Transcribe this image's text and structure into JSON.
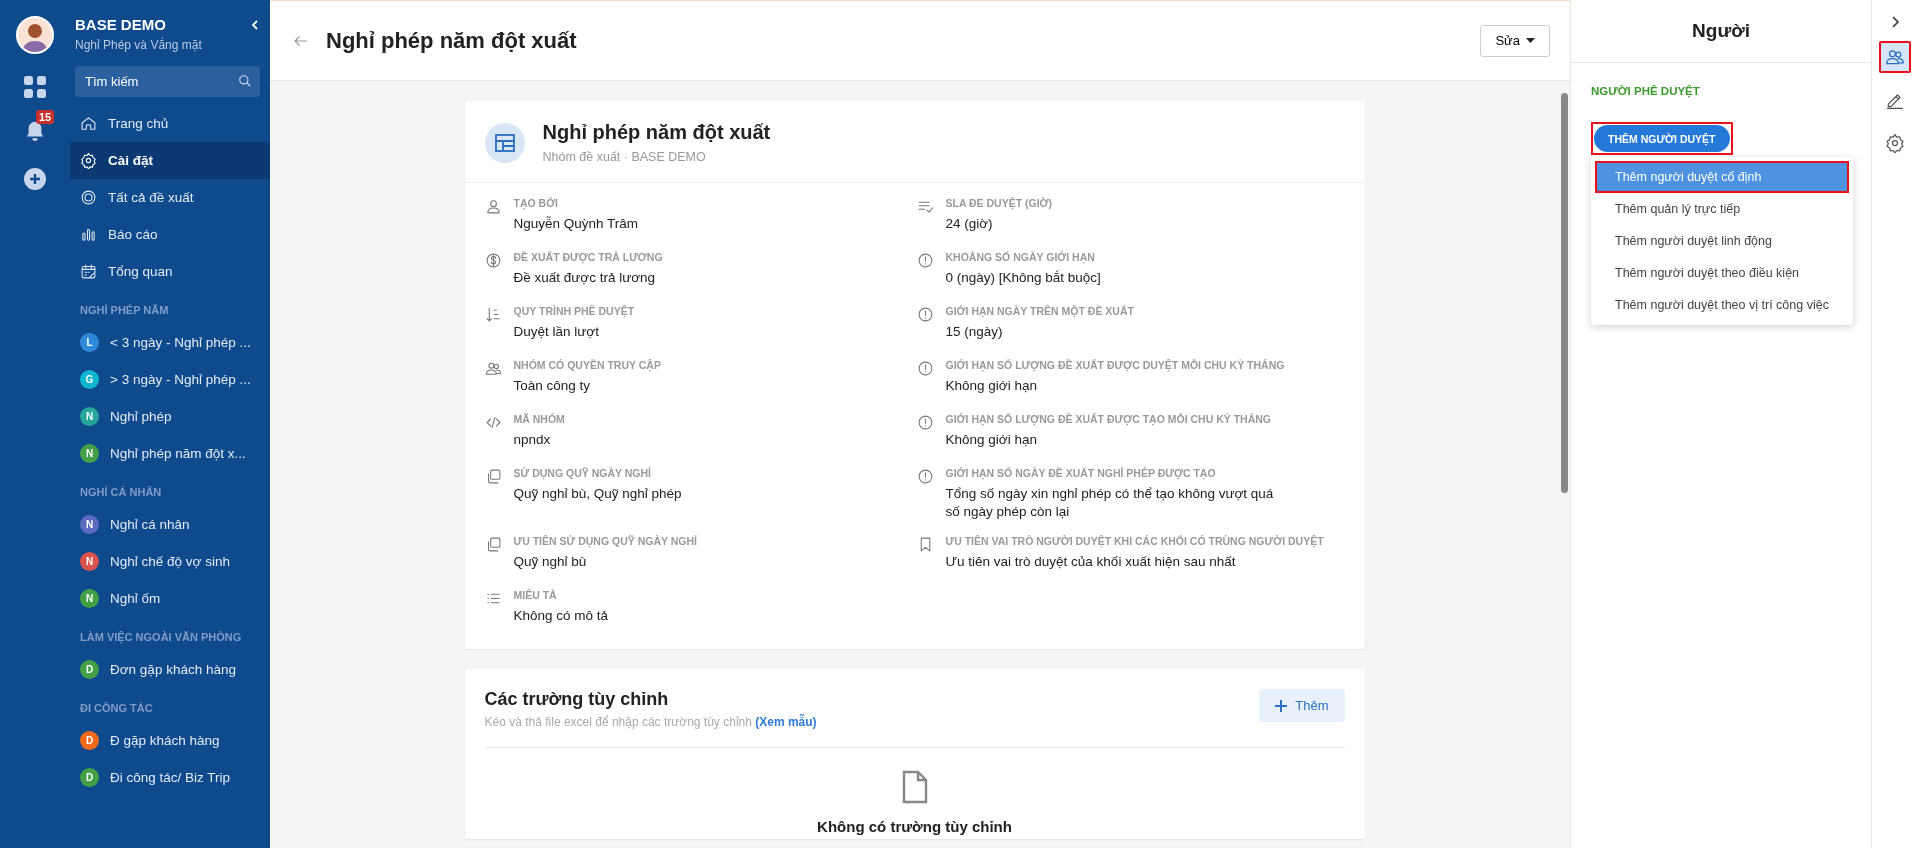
{
  "sidebar": {
    "org": "BASE DEMO",
    "app": "Nghỉ Phép và Vắng mặt",
    "search": {
      "placeholder": "Tìm kiếm"
    },
    "notifications": "15",
    "nav": [
      {
        "label": "Trang chủ",
        "selected": false
      },
      {
        "label": "Cài đặt",
        "selected": true
      },
      {
        "label": "Tất cả đề xuất",
        "selected": false
      },
      {
        "label": "Báo cáo",
        "selected": false
      },
      {
        "label": "Tổng quan",
        "selected": false
      }
    ],
    "groups": [
      {
        "title": "NGHỈ PHÉP NĂM",
        "items": [
          {
            "letter": "L",
            "color": "#2e8ad8",
            "label": "< 3 ngày - Nghỉ phép ..."
          },
          {
            "letter": "G",
            "color": "#11b5cf",
            "label": "> 3 ngày - Nghỉ phép ..."
          },
          {
            "letter": "N",
            "color": "#26a69a",
            "label": "Nghỉ phép"
          },
          {
            "letter": "N",
            "color": "#43a047",
            "label": "Nghỉ phép năm đột x..."
          }
        ]
      },
      {
        "title": "NGHỈ CÁ NHÂN",
        "items": [
          {
            "letter": "N",
            "color": "#5c6bc0",
            "label": "Nghỉ cá nhân"
          },
          {
            "letter": "N",
            "color": "#d9534f",
            "label": "Nghỉ chế độ vợ sinh"
          },
          {
            "letter": "N",
            "color": "#43a047",
            "label": "Nghỉ ốm"
          }
        ]
      },
      {
        "title": "LÀM VIỆC NGOÀI VĂN PHÒNG",
        "items": [
          {
            "letter": "D",
            "color": "#43a047",
            "label": "Đơn gặp khách hàng"
          }
        ]
      },
      {
        "title": "ĐI CÔNG TÁC",
        "items": [
          {
            "letter": "D",
            "color": "#f26b1d",
            "label": "Đ gặp khách hàng"
          },
          {
            "letter": "D",
            "color": "#43a047",
            "label": "Đi công tác/ Biz Trip"
          }
        ]
      }
    ]
  },
  "header": {
    "title": "Nghỉ phép năm đột xuất",
    "edit_button": "Sửa"
  },
  "card": {
    "title": "Nghỉ phép năm đột xuất",
    "subtitle": "Nhóm đề xuất · BASE DEMO",
    "left_fields": [
      {
        "label": "TẠO BỞI",
        "value": "Nguyễn Quỳnh Trâm"
      },
      {
        "label": "ĐỀ XUẤT ĐƯỢC TRẢ LƯƠNG",
        "value": "Đề xuất được trả lương"
      },
      {
        "label": "QUY TRÌNH PHÊ DUYỆT",
        "value": "Duyệt lần lượt"
      },
      {
        "label": "NHÓM CÓ QUYỀN TRUY CẬP",
        "value": "Toàn công ty"
      },
      {
        "label": "MÃ NHÓM",
        "value": "npndx"
      },
      {
        "label": "SỬ DỤNG QUỸ NGÀY NGHỈ",
        "value": "Quỹ nghỉ bù, Quỹ nghỉ phép"
      },
      {
        "label": "ƯU TIÊN SỬ DỤNG QUỸ NGÀY NGHỈ",
        "value": "Quỹ nghỉ bù"
      },
      {
        "label": "MIÊU TẢ",
        "value": "Không có mô tả"
      }
    ],
    "right_fields": [
      {
        "label": "SLA ĐỂ DUYỆT (GIỜ)",
        "value": "24 (giờ)"
      },
      {
        "label": "KHOẢNG SỐ NGÀY GIỚI HẠN",
        "value": "0 (ngày) [Không bắt buộc]"
      },
      {
        "label": "GIỚI HẠN NGÀY TRÊN MỘT ĐỀ XUẤT",
        "value": "15 (ngày)"
      },
      {
        "label": "GIỚI HẠN SỐ LƯỢNG ĐỀ XUẤT ĐƯỢC DUYỆT MỖI CHU KỲ THÁNG",
        "value": "Không giới hạn"
      },
      {
        "label": "GIỚI HẠN SỐ LƯỢNG ĐỀ XUẤT ĐƯỢC TẠO MỖI CHU KỲ THÁNG",
        "value": "Không giới hạn"
      },
      {
        "label": "GIỚI HẠN SỐ NGÀY ĐỀ XUẤT NGHỈ PHÉP ĐƯỢC TẠO",
        "value": "Tổng số ngày xin nghỉ phép có thể tạo không vượt quá số ngày phép còn lại"
      },
      {
        "label": "ƯU TIÊN VAI TRÒ NGƯỜI DUYỆT KHI CÁC KHỐI CÓ TRÙNG NGƯỜI DUYỆT",
        "value": "Ưu tiên vai trò duyệt của khối xuất hiện sau nhất"
      }
    ]
  },
  "custom_fields": {
    "title": "Các trường tùy chỉnh",
    "hint": "Kéo và thả file excel để nhập các trường tùy chỉnh",
    "link": "(Xem mẫu)",
    "add_button": "Thêm",
    "empty": "Không có trường tùy chỉnh"
  },
  "panel": {
    "title": "Người",
    "section": "NGƯỜI PHÊ DUYỆT",
    "add_button": {
      "label": "THÊM NGƯỜI DUYỆT",
      "annotated": true
    },
    "menu": [
      {
        "label": "Thêm người duyệt cố định",
        "selected": true,
        "annotated": true
      },
      {
        "label": "Thêm quản lý trực tiếp",
        "selected": false,
        "annotated": false
      },
      {
        "label": "Thêm người duyệt linh động",
        "selected": false,
        "annotated": false
      },
      {
        "label": "Thêm người duyệt theo điều kiện",
        "selected": false,
        "annotated": false
      },
      {
        "label": "Thêm người duyệt theo vị trí công việc",
        "selected": false,
        "annotated": false
      }
    ]
  },
  "rail": [
    {
      "selected": true,
      "annotated": true
    },
    {
      "selected": false,
      "annotated": false
    },
    {
      "selected": false,
      "annotated": false
    }
  ]
}
